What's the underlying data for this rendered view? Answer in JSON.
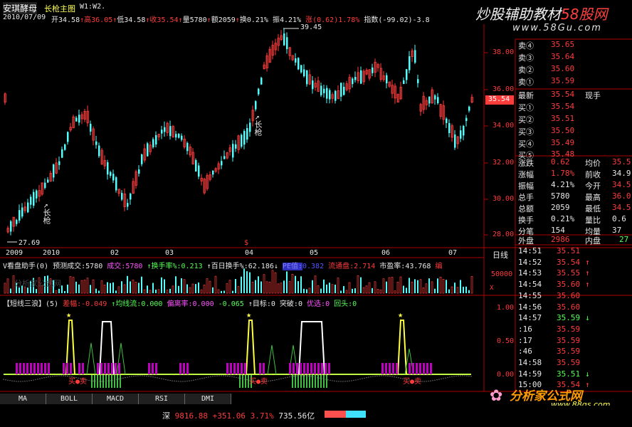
{
  "header": {
    "stock_name": "安琪酵母",
    "chart_name": "长枪主图",
    "params": "W1:W2.",
    "date": "2010/07/09",
    "open_label": "开",
    "open": "34.58",
    "high_label": "高",
    "high": "36.05",
    "low_label": "低",
    "low": "34.58",
    "close_label": "收",
    "close": "35.54",
    "vol_label": "量",
    "vol": "5780",
    "amt_label": "额",
    "amt": "2059",
    "turnover_label": "换",
    "turnover": "0.21%",
    "amp_label": "振",
    "amp": "4.21%",
    "chg_label": "涨",
    "chg": "(0.62)",
    "chg_pct": "1.78%",
    "index_label": "指数",
    "index": "(-99.02)-3.8"
  },
  "watermark": {
    "title": "炒股辅助教材",
    "brand": "58股网",
    "url": "www.58Gu.com",
    "bottom_brand": "分析家公式网",
    "bottom_url": "www.88gs.com",
    "mid_mark": "分析家公式网"
  },
  "main_chart": {
    "price_axis": [
      "38.00",
      "36.00",
      "34.00",
      "32.00",
      "30.00",
      "28.00"
    ],
    "current_price": "35.54",
    "high_marker": "39.45",
    "low_marker": "27.69",
    "signal_label_1": "长枪",
    "signal_label_2": "长枪",
    "signal_label_3": "长枪",
    "year_marker": "$",
    "time_axis": [
      "2009",
      "2010",
      "02",
      "03",
      "04",
      "05",
      "06",
      "07"
    ],
    "period": "日线"
  },
  "volume_panel": {
    "title": "V看盘助手(0)",
    "forecast_label": "预测成交:",
    "forecast": "5780",
    "deal_label": "成交:",
    "deal": "5780",
    "turnover_label": "换手率%:",
    "turnover": "0.213",
    "hundred_label": "百日换手%:",
    "hundred": "62.186",
    "pe_label": "PE值:",
    "pe": "0.382",
    "circ_label": "流通盘:",
    "circ": "2.714",
    "mkt_label": "市盈率:",
    "mkt": "43.768",
    "extra": "编",
    "axis": "50000",
    "axis_unit": "X"
  },
  "indicator_panel": {
    "title": "【短线三浪】",
    "param": "(5)",
    "diff_label": "差幅:",
    "diff": "-0.049",
    "ma_label": "均线流:",
    "ma": "0.000",
    "dev_label": "偏离率:",
    "dev": "0.000",
    "dev2": "-0.065",
    "target_label": "目标:",
    "target": "0",
    "break_label": "突破:",
    "break": "0",
    "pick_label": "优选:",
    "pick": "0",
    "back_label": "回头:",
    "back": "0",
    "axis": [
      "1.00",
      "0.50",
      "0.00"
    ],
    "buy_label": "买",
    "sell_label": "卖"
  },
  "quote": {
    "sell": [
      {
        "label": "卖④",
        "price": "35.65"
      },
      {
        "label": "卖③",
        "price": "35.64"
      },
      {
        "label": "卖②",
        "price": "35.60"
      },
      {
        "label": "卖①",
        "price": "35.59"
      }
    ],
    "latest_label": "最新",
    "latest": "35.54",
    "cash_label": "现手",
    "buy": [
      {
        "label": "买①",
        "price": "35.54"
      },
      {
        "label": "买②",
        "price": "35.51"
      },
      {
        "label": "买③",
        "price": "35.50"
      },
      {
        "label": "买④",
        "price": "35.49"
      },
      {
        "label": "买⑤",
        "price": "35.48"
      }
    ],
    "stats": [
      {
        "l1": "涨跌",
        "v1": "0.62",
        "l2": "均价",
        "v2": "35.5"
      },
      {
        "l1": "涨幅",
        "v1": "1.78%",
        "l2": "前收",
        "v2": "34.9"
      },
      {
        "l1": "振幅",
        "v1": "4.21%",
        "l2": "今开",
        "v2": "34.5"
      },
      {
        "l1": "总手",
        "v1": "5780",
        "l2": "最高",
        "v2": "36.0"
      },
      {
        "l1": "总额",
        "v1": "2059",
        "l2": "最低",
        "v2": "34.5"
      },
      {
        "l1": "换手",
        "v1": "0.21%",
        "l2": "量比",
        "v2": "0.6"
      },
      {
        "l1": "分笔",
        "v1": "154",
        "l2": "均量",
        "v2": "37"
      }
    ],
    "outer_label": "外盘",
    "outer": "2986",
    "inner_label": "内盘",
    "inner": "27"
  },
  "ticks": [
    {
      "time": "14:51",
      "price": "35.51",
      "arrow": ""
    },
    {
      "time": "14:52",
      "price": "35.54",
      "arrow": "↑"
    },
    {
      "time": "14:53",
      "price": "35.55",
      "arrow": "↑"
    },
    {
      "time": "14:54",
      "price": "35.60",
      "arrow": "↑"
    },
    {
      "time": "14:55",
      "price": "35.60",
      "arrow": ""
    },
    {
      "time": "14:56",
      "price": "35.60",
      "arrow": ""
    },
    {
      "time": "14:57",
      "price": "35.59",
      "arrow": "↓"
    },
    {
      "time": ":16",
      "price": "35.59",
      "arrow": ""
    },
    {
      "time": ":17",
      "price": "35.59",
      "arrow": ""
    },
    {
      "time": ":46",
      "price": "35.59",
      "arrow": ""
    },
    {
      "time": "14:58",
      "price": "35.59",
      "arrow": ""
    },
    {
      "time": "14:59",
      "price": "35.51",
      "arrow": "↓"
    },
    {
      "time": "15:00",
      "price": "35.54",
      "arrow": "↑"
    }
  ],
  "tabs": [
    "MA",
    "BOLL",
    "MACD",
    "RSI",
    "DMI"
  ],
  "status": {
    "market": "深",
    "index": "9816.88",
    "change": "+351.06",
    "pct": "3.71%",
    "volume": "735.56亿"
  }
}
